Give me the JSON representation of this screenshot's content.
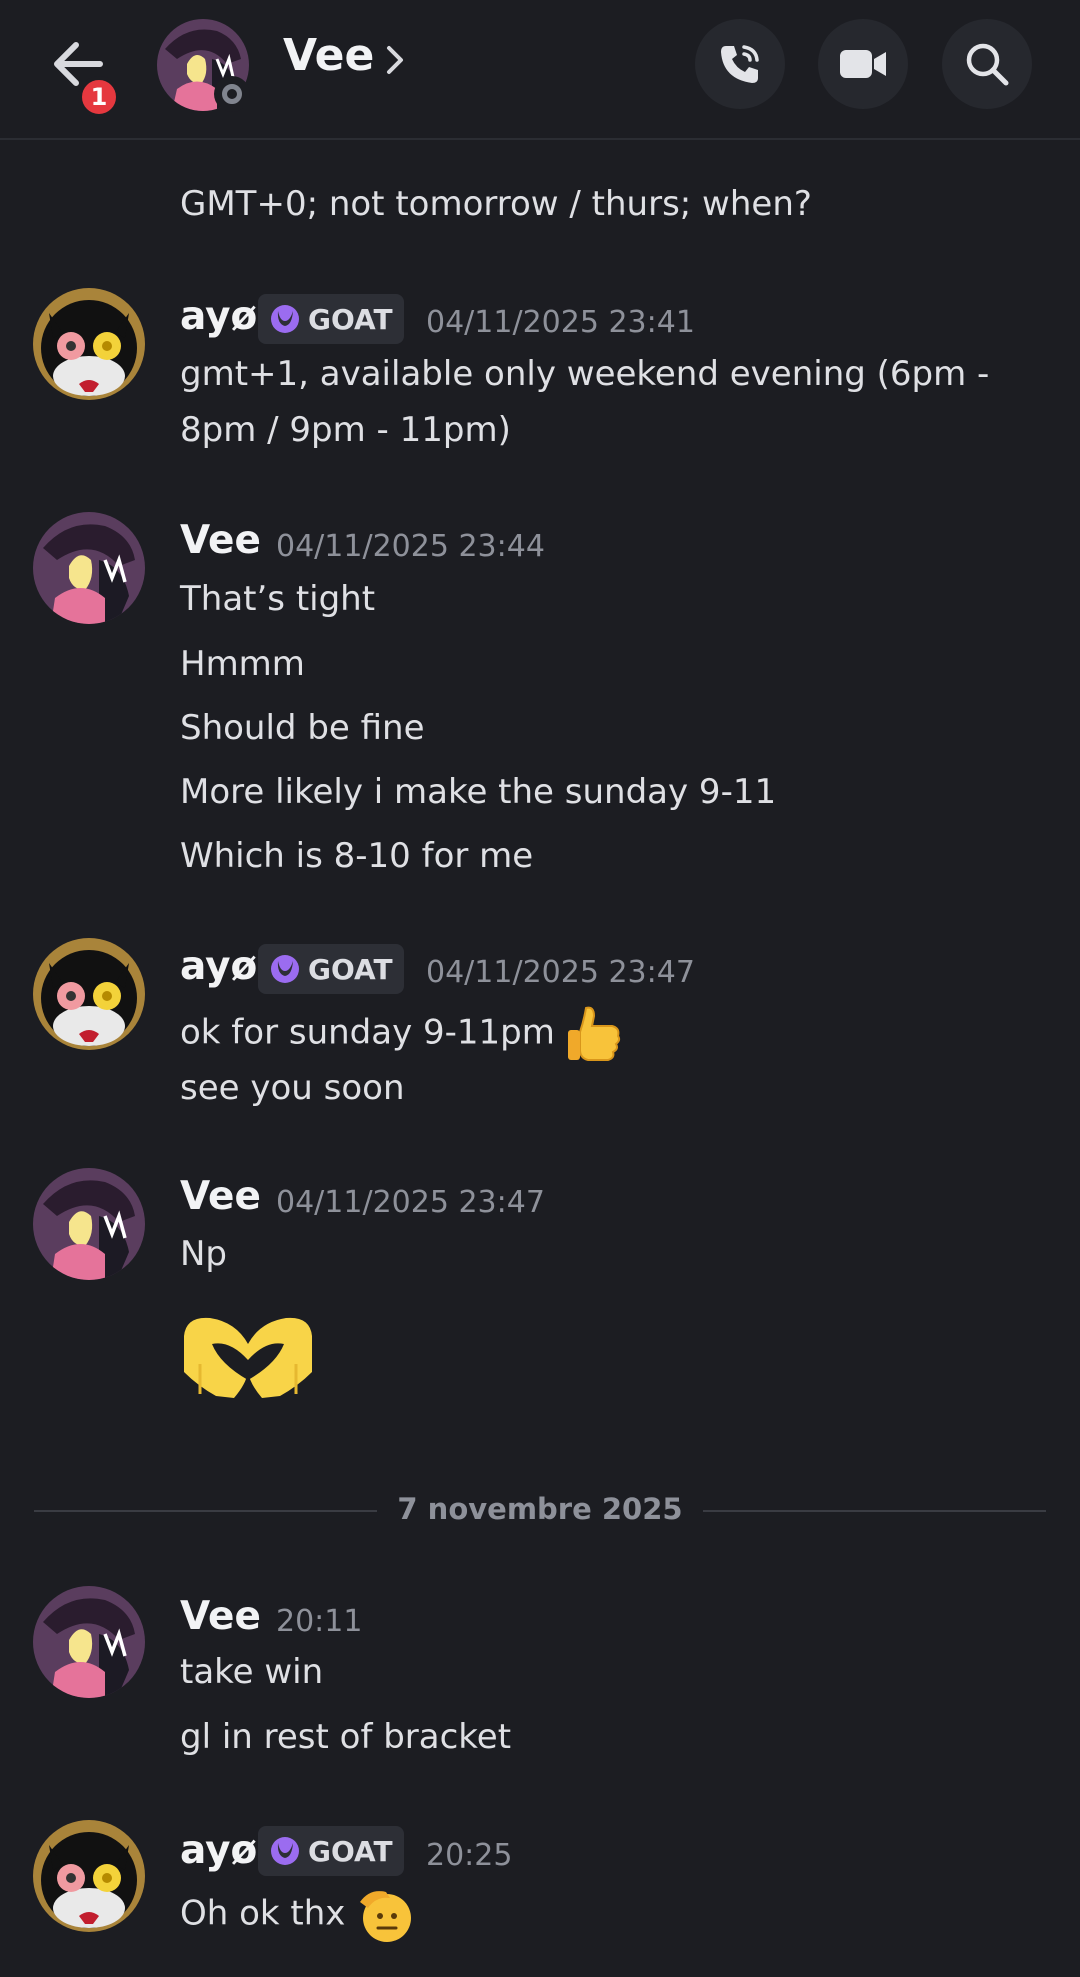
{
  "header": {
    "back_badge": "1",
    "contact_name": "Vee"
  },
  "messages": {
    "m0": {
      "text": "GMT+0; not tomorrow / thurs; when?"
    },
    "m1": {
      "author": "ayø",
      "tag": "GOAT",
      "time": "04/11/2025 23:41",
      "line1": "gmt+1, available only weekend evening (6pm -",
      "line2": "8pm / 9pm - 11pm)"
    },
    "m2": {
      "author": "Vee",
      "time": "04/11/2025 23:44",
      "lines": [
        "That’s tight",
        "Hmmm",
        "Should be fine",
        "More likely i make the sunday 9-11",
        "Which is 8-10 for me"
      ]
    },
    "m3": {
      "author": "ayø",
      "tag": "GOAT",
      "time": "04/11/2025 23:47",
      "line1": "ok for sunday 9-11pm",
      "line2": "see you soon"
    },
    "m4": {
      "author": "Vee",
      "time": "04/11/2025 23:47",
      "line1": "Np"
    },
    "divider": "7 novembre 2025",
    "m5": {
      "author": "Vee",
      "time": "20:11",
      "line1": "take win",
      "line2": "gl in rest of bracket"
    },
    "m6": {
      "author": "ayø",
      "tag": "GOAT",
      "time": "20:25",
      "line1": "Oh ok thx"
    }
  },
  "icons": {
    "back": "arrow-left-icon",
    "call": "phone-icon",
    "video": "video-camera-icon",
    "search": "search-icon",
    "thumbs_up": "thumbs-up-emoji",
    "heart_hands": "heart-hands-emoji",
    "salute": "saluting-face-emoji"
  },
  "colors": {
    "background": "#1c1d22",
    "badge": "#e5383f",
    "tag_icon": "#9b6cf0",
    "emoji_yellow": "#f8d448"
  }
}
